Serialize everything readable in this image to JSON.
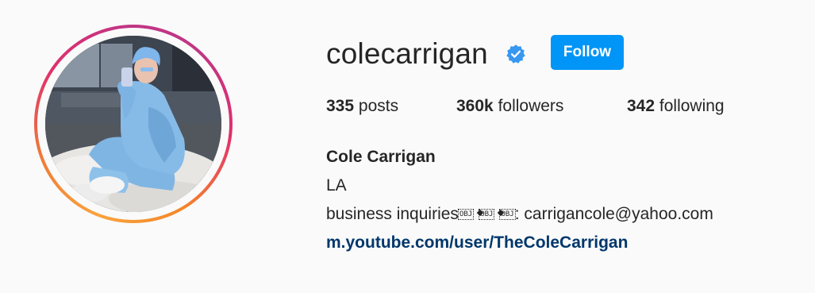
{
  "profile": {
    "username": "colecarrigan",
    "verified": true,
    "follow_label": "Follow",
    "avatar_icon": "profile-photo",
    "verified_icon": "verified-badge-icon"
  },
  "stats": {
    "posts_count": "335",
    "posts_label": "posts",
    "followers_count": "360k",
    "followers_label": "followers",
    "following_count": "342",
    "following_label": "following"
  },
  "bio": {
    "full_name": "Cole Carrigan",
    "location": "LA",
    "line_prefix": "business inquiries",
    "emoji_placeholder": "OBJ",
    "line_suffix": ": carrigancole@yahoo.com",
    "link": "m.youtube.com/user/TheColeCarrigan"
  },
  "colors": {
    "accent": "#0095f6",
    "link": "#00376b",
    "text": "#262626",
    "background": "#fafafa"
  }
}
